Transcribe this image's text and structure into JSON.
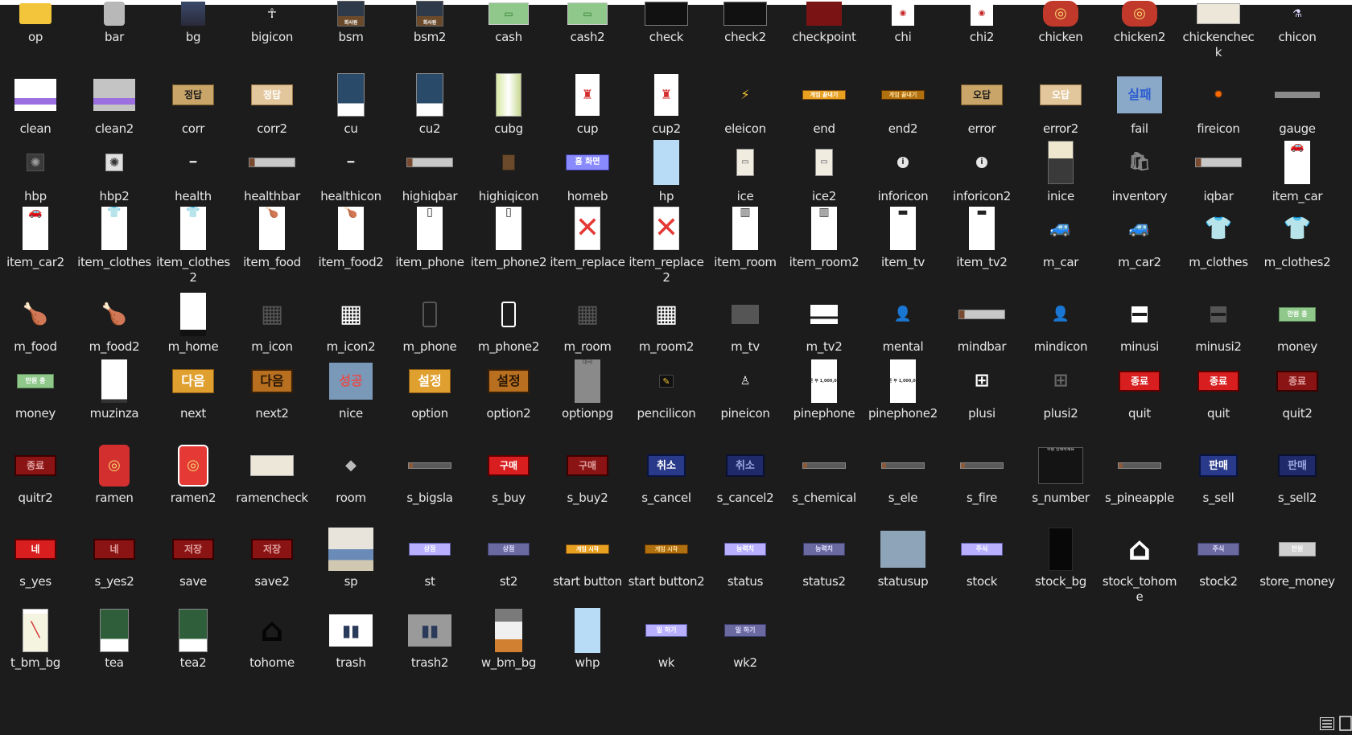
{
  "window": {
    "accent": "#ffffff",
    "background": "#1c1c1c",
    "text_color": "#e6e6e6"
  },
  "files": [
    {
      "name": "op",
      "kind": "folder"
    },
    {
      "name": "bar",
      "kind": "gray-bar"
    },
    {
      "name": "bg",
      "kind": "city"
    },
    {
      "name": "bigicon",
      "kind": "person-icon"
    },
    {
      "name": "bsm",
      "kind": "scene",
      "text": "회사원"
    },
    {
      "name": "bsm2",
      "kind": "scene",
      "text": "회사원"
    },
    {
      "name": "cash",
      "kind": "banknote"
    },
    {
      "name": "cash2",
      "kind": "banknote"
    },
    {
      "name": "check",
      "kind": "dark-card"
    },
    {
      "name": "check2",
      "kind": "dark-card"
    },
    {
      "name": "checkpoint",
      "kind": "red-square"
    },
    {
      "name": "chi",
      "kind": "phone-card"
    },
    {
      "name": "chi2",
      "kind": "phone-card"
    },
    {
      "name": "chicken",
      "kind": "chicken-cup"
    },
    {
      "name": "chicken2",
      "kind": "chicken-cup"
    },
    {
      "name": "chickencheck",
      "kind": "receipt"
    },
    {
      "name": "chicon",
      "kind": "flask-icon"
    },
    {
      "name": "clean",
      "kind": "purple-sheet"
    },
    {
      "name": "clean2",
      "kind": "purple-sheet-gray"
    },
    {
      "name": "corr",
      "kind": "tan-button",
      "text": "정답"
    },
    {
      "name": "corr2",
      "kind": "tan-button-light",
      "text": "정답"
    },
    {
      "name": "cu",
      "kind": "store"
    },
    {
      "name": "cu2",
      "kind": "store"
    },
    {
      "name": "cubg",
      "kind": "shelf"
    },
    {
      "name": "cup",
      "kind": "ramen-card"
    },
    {
      "name": "cup2",
      "kind": "ramen-card"
    },
    {
      "name": "eleicon",
      "kind": "bolt-icon"
    },
    {
      "name": "end",
      "kind": "orange-banner",
      "text": "게임 끝내기"
    },
    {
      "name": "end2",
      "kind": "orange-banner-dark",
      "text": "게임 끝내기"
    },
    {
      "name": "error",
      "kind": "tan-button",
      "text": "오답"
    },
    {
      "name": "error2",
      "kind": "tan-button-light",
      "text": "오답"
    },
    {
      "name": "fail",
      "kind": "blue-fail",
      "text": "실패"
    },
    {
      "name": "fireicon",
      "kind": "fire-icon"
    },
    {
      "name": "gauge",
      "kind": "gauge-bar"
    },
    {
      "name": "hbp",
      "kind": "gear-icon"
    },
    {
      "name": "hbp2",
      "kind": "gear-icon-light"
    },
    {
      "name": "health",
      "kind": "dumbbell-icon"
    },
    {
      "name": "healthbar",
      "kind": "progress-bar"
    },
    {
      "name": "healthicon",
      "kind": "dumbbell-icon"
    },
    {
      "name": "highiqbar",
      "kind": "progress-bar"
    },
    {
      "name": "highiqicon",
      "kind": "book-icon"
    },
    {
      "name": "homeb",
      "kind": "purple-button",
      "text": "홈 화면"
    },
    {
      "name": "hp",
      "kind": "light-blue-panel"
    },
    {
      "name": "ice",
      "kind": "fridge-card"
    },
    {
      "name": "ice2",
      "kind": "fridge-card"
    },
    {
      "name": "inforicon",
      "kind": "info-icon"
    },
    {
      "name": "inforicon2",
      "kind": "info-icon"
    },
    {
      "name": "inice",
      "kind": "fridge-inside"
    },
    {
      "name": "inventory",
      "kind": "bag-icon"
    },
    {
      "name": "iqbar",
      "kind": "progress-bar"
    },
    {
      "name": "item_car",
      "kind": "item-card",
      "glyph": "🚗"
    },
    {
      "name": "item_car2",
      "kind": "item-card",
      "glyph": "🚗"
    },
    {
      "name": "item_clothes",
      "kind": "item-card",
      "glyph": "👕"
    },
    {
      "name": "item_clothes2",
      "kind": "item-card",
      "glyph": "👕"
    },
    {
      "name": "item_food",
      "kind": "item-card",
      "glyph": "🍗"
    },
    {
      "name": "item_food2",
      "kind": "item-card",
      "glyph": "🍗"
    },
    {
      "name": "item_phone",
      "kind": "item-card",
      "glyph": "▯"
    },
    {
      "name": "item_phone2",
      "kind": "item-card",
      "glyph": "▯"
    },
    {
      "name": "item_replace",
      "kind": "replace-card"
    },
    {
      "name": "item_replace2",
      "kind": "replace-card"
    },
    {
      "name": "item_room",
      "kind": "item-card",
      "glyph": "▥"
    },
    {
      "name": "item_room2",
      "kind": "item-card",
      "glyph": "▥"
    },
    {
      "name": "item_tv",
      "kind": "item-card",
      "glyph": "▬"
    },
    {
      "name": "item_tv2",
      "kind": "item-card",
      "glyph": "▬"
    },
    {
      "name": "m_car",
      "kind": "car-icon-dark"
    },
    {
      "name": "m_car2",
      "kind": "car-icon-light"
    },
    {
      "name": "m_clothes",
      "kind": "shirt-icon-dark"
    },
    {
      "name": "m_clothes2",
      "kind": "shirt-icon-light"
    },
    {
      "name": "m_food",
      "kind": "drumstick-icon-dark"
    },
    {
      "name": "m_food2",
      "kind": "drumstick-icon-light"
    },
    {
      "name": "m_home",
      "kind": "home-screen"
    },
    {
      "name": "m_icon",
      "kind": "building-icon-dark"
    },
    {
      "name": "m_icon2",
      "kind": "building-icon-light"
    },
    {
      "name": "m_phone",
      "kind": "phone-icon-dark"
    },
    {
      "name": "m_phone2",
      "kind": "phone-icon-light"
    },
    {
      "name": "m_room",
      "kind": "building-icon-dark"
    },
    {
      "name": "m_room2",
      "kind": "building-icon-light"
    },
    {
      "name": "m_tv",
      "kind": "tv-icon-dark"
    },
    {
      "name": "m_tv2",
      "kind": "tv-icon-light"
    },
    {
      "name": "mental",
      "kind": "user-icon"
    },
    {
      "name": "mindbar",
      "kind": "progress-bar"
    },
    {
      "name": "mindicon",
      "kind": "user-icon"
    },
    {
      "name": "minusi",
      "kind": "minus-icon"
    },
    {
      "name": "minusi2",
      "kind": "minus-icon-dark"
    },
    {
      "name": "money",
      "kind": "money-note",
      "text": "만원 충"
    },
    {
      "name": "money",
      "kind": "money-note",
      "text": "만원 충"
    },
    {
      "name": "muzinza",
      "kind": "sketch"
    },
    {
      "name": "next",
      "kind": "gold-button",
      "text": "다음"
    },
    {
      "name": "next2",
      "kind": "brown-button",
      "text": "다음"
    },
    {
      "name": "nice",
      "kind": "blue-success",
      "text": "성공"
    },
    {
      "name": "option",
      "kind": "gold-button",
      "text": "설정"
    },
    {
      "name": "option2",
      "kind": "brown-button",
      "text": "설정"
    },
    {
      "name": "optionpg",
      "kind": "gray-page",
      "text": "대국"
    },
    {
      "name": "pencilicon",
      "kind": "pencil-icon"
    },
    {
      "name": "pineicon",
      "kind": "pine-icon"
    },
    {
      "name": "pinephone",
      "kind": "pine-card",
      "text": "파인폰 부 1,000,000원"
    },
    {
      "name": "pinephone2",
      "kind": "pine-card",
      "text": "파인폰 부 1,000,000원"
    },
    {
      "name": "plusi",
      "kind": "plus-icon"
    },
    {
      "name": "plusi2",
      "kind": "plus-icon-dark"
    },
    {
      "name": "quit",
      "kind": "red-button",
      "text": "종료"
    },
    {
      "name": "quit",
      "kind": "red-button",
      "text": "종료"
    },
    {
      "name": "quit2",
      "kind": "dark-red-button",
      "text": "종료"
    },
    {
      "name": "quitr2",
      "kind": "dark-red-button",
      "text": "종료"
    },
    {
      "name": "ramen",
      "kind": "ramen-cup"
    },
    {
      "name": "ramen2",
      "kind": "ramen-cup-outline"
    },
    {
      "name": "ramencheck",
      "kind": "receipt"
    },
    {
      "name": "room",
      "kind": "box-icon"
    },
    {
      "name": "s_bigsla",
      "kind": "thin-bar"
    },
    {
      "name": "s_buy",
      "kind": "red-button",
      "text": "구매"
    },
    {
      "name": "s_buy2",
      "kind": "dark-red-button",
      "text": "구매"
    },
    {
      "name": "s_cancel",
      "kind": "navy-button",
      "text": "취소"
    },
    {
      "name": "s_cancel2",
      "kind": "navy-button-dark",
      "text": "취소"
    },
    {
      "name": "s_chemical",
      "kind": "thin-bar"
    },
    {
      "name": "s_ele",
      "kind": "thin-bar"
    },
    {
      "name": "s_fire",
      "kind": "thin-bar"
    },
    {
      "name": "s_number",
      "kind": "number-panel",
      "text": "수량 선택하세요"
    },
    {
      "name": "s_pineapple",
      "kind": "thin-bar"
    },
    {
      "name": "s_sell",
      "kind": "navy-button",
      "text": "판매"
    },
    {
      "name": "s_sell2",
      "kind": "navy-button-dark",
      "text": "판매"
    },
    {
      "name": "s_yes",
      "kind": "red-button",
      "text": "네"
    },
    {
      "name": "s_yes2",
      "kind": "dark-red-button",
      "text": "네"
    },
    {
      "name": "save",
      "kind": "dark-red-button",
      "text": "저장"
    },
    {
      "name": "save2",
      "kind": "dark-red-button",
      "text": "저장"
    },
    {
      "name": "sp",
      "kind": "sp-scene"
    },
    {
      "name": "st",
      "kind": "lavender-button",
      "text": "상점"
    },
    {
      "name": "st2",
      "kind": "slate-button",
      "text": "상점"
    },
    {
      "name": "start button",
      "kind": "orange-banner",
      "text": "게임 시작"
    },
    {
      "name": "start button2",
      "kind": "orange-banner-dark",
      "text": "게임 시작"
    },
    {
      "name": "status",
      "kind": "lavender-button",
      "text": "능력치"
    },
    {
      "name": "status2",
      "kind": "slate-button",
      "text": "능력치"
    },
    {
      "name": "statusup",
      "kind": "blue-gray-square"
    },
    {
      "name": "stock",
      "kind": "lavender-button",
      "text": "주식"
    },
    {
      "name": "stock_bg",
      "kind": "black-panel"
    },
    {
      "name": "stock_tohome",
      "kind": "home-outline-icon"
    },
    {
      "name": "stock2",
      "kind": "slate-button",
      "text": "주식"
    },
    {
      "name": "store_money",
      "kind": "money-note-gray",
      "text": "만원"
    },
    {
      "name": "t_bm_bg",
      "kind": "notepad"
    },
    {
      "name": "tea",
      "kind": "teacher",
      "text": "교사"
    },
    {
      "name": "tea2",
      "kind": "teacher",
      "text": "교사"
    },
    {
      "name": "tohome",
      "kind": "home-outline-dark"
    },
    {
      "name": "trash",
      "kind": "trash-bags"
    },
    {
      "name": "trash2",
      "kind": "trash-bags-gray"
    },
    {
      "name": "w_bm_bg",
      "kind": "desk"
    },
    {
      "name": "whp",
      "kind": "light-blue-panel"
    },
    {
      "name": "wk",
      "kind": "lavender-button",
      "text": "일 하기"
    },
    {
      "name": "wk2",
      "kind": "slate-button",
      "text": "일 하기"
    }
  ],
  "statusbar": {
    "details_view_icon": "details-view-icon",
    "large_icons_view_icon": "large-icons-view-icon"
  }
}
